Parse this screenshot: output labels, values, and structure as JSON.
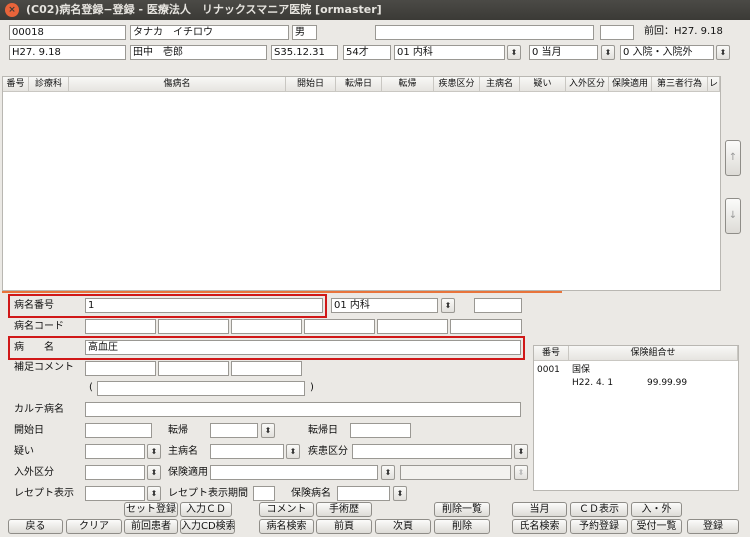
{
  "window": {
    "title": "(C02)病名登録−登録 - 医療法人　リナックスマニア医院 [ormaster]"
  },
  "patient": {
    "id": "00018",
    "kana": "タナカ　イチロウ",
    "sex": "男",
    "blank1": "",
    "blank2": "",
    "last_visit": "前回：H27. 9.18",
    "date": "H27. 9.18",
    "name": "田中　壱郎",
    "birth": "S35.12.31",
    "age": "54才",
    "dept": "01 内科",
    "month_select": "0 当月",
    "inout_select": "0 入院・入院外"
  },
  "table": {
    "headers": [
      "番号",
      "診療科",
      "傷病名",
      "開始日",
      "転帰日",
      "転帰",
      "疾患区分",
      "主病名",
      "疑い",
      "入外区分",
      "保険適用",
      "第三者行為",
      "レ"
    ],
    "up": "↑",
    "down": "↓"
  },
  "form": {
    "disease_no_label": "病名番号",
    "disease_no": "1",
    "dept_value": "01 内科",
    "extra_box": "",
    "code_label": "病名コード",
    "name_label": "病　　名",
    "name_value": "高血圧",
    "comment_label": "補足コメント",
    "paren_open": "(",
    "paren_close": ")",
    "karte_label": "カルテ病名",
    "start_label": "開始日",
    "tenki_label": "転帰",
    "tenki_date_label": "転帰日",
    "doubt_label": "疑い",
    "main_label": "主病名",
    "cat_label": "疾患区分",
    "inout_label": "入外区分",
    "insurance_label": "保険適用",
    "receipt_label": "レセプト表示",
    "receipt_period_label": "レセプト表示期間",
    "insurance_disease_label": "保険病名"
  },
  "insurance_panel": {
    "col_no": "番号",
    "col_combo": "保険組合せ",
    "no": "0001",
    "type": "国保",
    "date": "H22. 4. 1",
    "range": "99.99.99"
  },
  "buttons": {
    "set_reg": "セット登録",
    "input_cd": "入力ＣＤ",
    "comment": "コメント",
    "surgery": "手術歴",
    "delete_list": "削除一覧",
    "current_month": "当月",
    "cd_show": "ＣＤ表示",
    "in_out": "入・外",
    "back": "戻る",
    "clear": "クリア",
    "prev_patient": "前回患者",
    "input_cd_search": "入力CD検索",
    "disease_search": "病名検索",
    "prev_page": "前頁",
    "next_page": "次頁",
    "delete": "削除",
    "name_search": "氏名検索",
    "reservation": "予約登録",
    "reception_list": "受付一覧",
    "register": "登録"
  },
  "colors": {
    "titlebar": "#3b3a36",
    "highlight": "#d01818",
    "window_bg": "#ebe9e5",
    "divider": "#e8743b"
  }
}
